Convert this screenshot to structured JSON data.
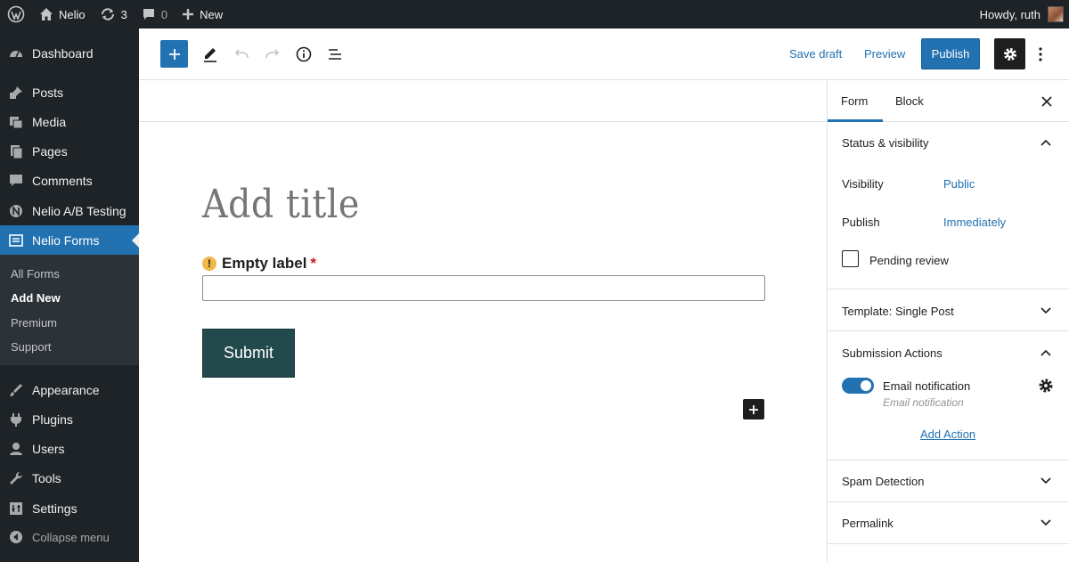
{
  "admin_bar": {
    "site_name": "Nelio",
    "updates_count": "3",
    "comments_count": "0",
    "new_label": "New",
    "greeting": "Howdy, ruth"
  },
  "sidebar": {
    "items": [
      {
        "label": "Dashboard",
        "icon": "dashboard-icon"
      },
      {
        "label": "Posts",
        "icon": "pin-icon"
      },
      {
        "label": "Media",
        "icon": "media-icon"
      },
      {
        "label": "Pages",
        "icon": "pages-icon"
      },
      {
        "label": "Comments",
        "icon": "comment-icon"
      },
      {
        "label": "Nelio A/B Testing",
        "icon": "nelio-ab-icon"
      },
      {
        "label": "Nelio Forms",
        "icon": "forms-icon"
      },
      {
        "label": "Appearance",
        "icon": "brush-icon"
      },
      {
        "label": "Plugins",
        "icon": "plugin-icon"
      },
      {
        "label": "Users",
        "icon": "user-icon"
      },
      {
        "label": "Tools",
        "icon": "wrench-icon"
      },
      {
        "label": "Settings",
        "icon": "settings-icon"
      }
    ],
    "submenu": [
      "All Forms",
      "Add New",
      "Premium",
      "Support"
    ],
    "collapse_label": "Collapse menu"
  },
  "header": {
    "save_draft": "Save draft",
    "preview": "Preview",
    "publish": "Publish"
  },
  "editor": {
    "title_placeholder": "Add title",
    "field_label": "Empty label",
    "required_mark": "*",
    "warning_glyph": "!",
    "input_value": "",
    "submit_label": "Submit"
  },
  "panel": {
    "tabs": [
      "Form",
      "Block"
    ],
    "status_visibility": {
      "title": "Status & visibility",
      "visibility_label": "Visibility",
      "visibility_value": "Public",
      "publish_label": "Publish",
      "publish_value": "Immediately",
      "pending_review": "Pending review"
    },
    "template": "Template: Single Post",
    "submission_actions": {
      "title": "Submission Actions",
      "action_name": "Email notification",
      "action_sub": "Email notification",
      "add_action": "Add Action"
    },
    "spam_detection": "Spam Detection",
    "permalink": "Permalink"
  },
  "colors": {
    "admin_dark": "#1d2327",
    "accent": "#2271b1",
    "submit_bg": "#224a4c"
  }
}
